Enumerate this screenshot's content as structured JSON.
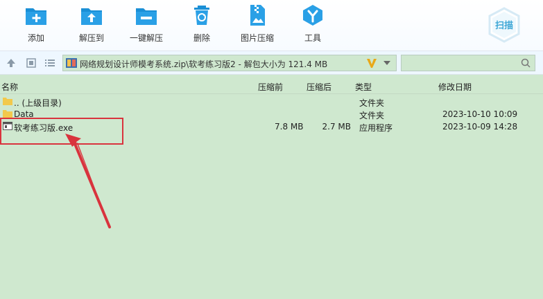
{
  "toolbar": {
    "add": "添加",
    "extract_to": "解压到",
    "one_key_extract": "一键解压",
    "delete": "删除",
    "image_compress": "图片压缩",
    "tools": "工具",
    "scan": "扫描"
  },
  "address": {
    "path": "网络规划设计师模考系统.zip\\软考练习版2 - 解包大小为 121.4 MB"
  },
  "columns": {
    "name": "名称",
    "compressed": "压缩前",
    "original": "压缩后",
    "type": "类型",
    "modified": "修改日期"
  },
  "files": [
    {
      "name": ".. (上级目录)",
      "compressed": "",
      "original": "",
      "type": "文件夹",
      "modified": ""
    },
    {
      "name": "Data",
      "compressed": "",
      "original": "",
      "type": "文件夹",
      "modified": "2023-10-10 10:09"
    },
    {
      "name": "软考练习版.exe",
      "compressed": "7.8 MB",
      "original": "2.7 MB",
      "type": "应用程序",
      "modified": "2023-10-09 14:28"
    }
  ],
  "colors": {
    "accent": "#1a8fd6",
    "list_bg": "#cfe8cf",
    "highlight": "#d9333d"
  }
}
